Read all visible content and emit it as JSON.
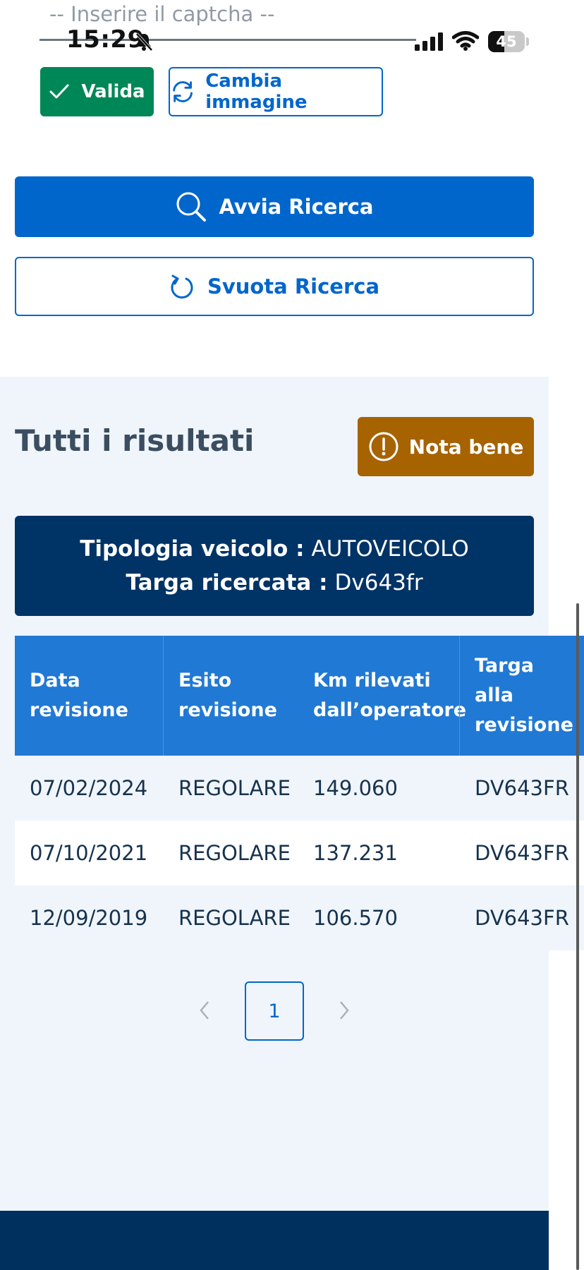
{
  "status_bar": {
    "time": "15:29",
    "battery": "45"
  },
  "captcha": {
    "placeholder": "-- Inserire il captcha --",
    "valida_label": "Valida",
    "cambia_label": "Cambia immagine"
  },
  "search": {
    "avvia_label": "Avvia Ricerca",
    "svuota_label": "Svuota Ricerca"
  },
  "results": {
    "title": "Tutti i risultati",
    "nota_label": "Nota bene",
    "tipologia_label": "Tipologia veicolo :",
    "tipologia_value": "AUTOVEICOLO",
    "targa_label": "Targa ricercata :",
    "targa_value": "Dv643fr"
  },
  "table": {
    "headers": [
      {
        "line1": "Data",
        "line2": "revisione",
        "line3": ""
      },
      {
        "line1": "Esito",
        "line2": "revisione",
        "line3": ""
      },
      {
        "line1": "Km rilevati",
        "line2": "dall’operatore",
        "line3": ""
      },
      {
        "line1": "Targa",
        "line2": "alla",
        "line3": "revisione"
      }
    ],
    "rows": [
      [
        "07/02/2024",
        "REGOLARE",
        "149.060",
        "DV643FR"
      ],
      [
        "07/10/2021",
        "REGOLARE",
        "137.231",
        "DV643FR"
      ],
      [
        "12/09/2019",
        "REGOLARE",
        "106.570",
        "DV643FR"
      ]
    ]
  },
  "pagination": {
    "current_page": "1"
  },
  "colors": {
    "primary": "#0066cc",
    "success": "#008758",
    "warning": "#a66300",
    "dark_blue": "#003366",
    "table_header": "#2079d4",
    "section_bg": "#eff5fb"
  }
}
